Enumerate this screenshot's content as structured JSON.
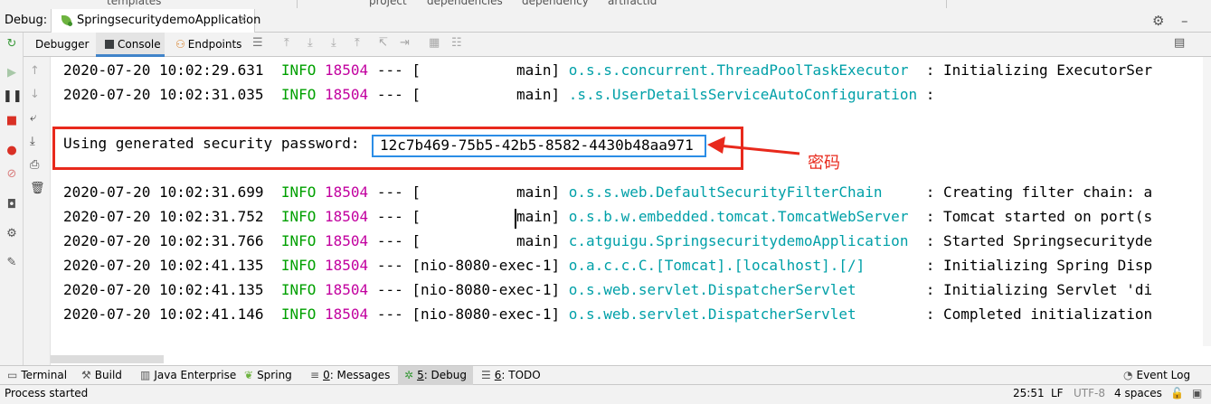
{
  "top_strip": {
    "fragments": [
      "templates",
      "project",
      "dependencies",
      "dependency",
      "artifactId"
    ]
  },
  "title_bar": {
    "label": "Debug:",
    "run_tab": "SpringsecuritydemoApplication",
    "close": "×",
    "settings_icon": "gear-icon",
    "minimize_icon": "minimize-icon"
  },
  "tabs": {
    "debugger": "Debugger",
    "console": "Console",
    "endpoints": "Endpoints",
    "active": "Console"
  },
  "console": {
    "lines_top": [
      {
        "date": "2020-07-20 10:02:29.631",
        "level": "INFO",
        "pid": "18504",
        "sep": "---",
        "thread": "[           main]",
        "logger": "o.s.s.concurrent.ThreadPoolTaskExecutor",
        "message": ": Initializing ExecutorSer"
      },
      {
        "date": "2020-07-20 10:02:31.035",
        "level": "INFO",
        "pid": "18504",
        "sep": "---",
        "thread": "[           main]",
        "logger": ".s.s.UserDetailsServiceAutoConfiguration",
        "message": ":"
      }
    ],
    "password_line": {
      "prefix": "Using generated security password:",
      "value": "12c7b469-75b5-42b5-8582-4430b48aa971"
    },
    "lines_bottom": [
      {
        "date": "2020-07-20 10:02:31.699",
        "level": "INFO",
        "pid": "18504",
        "sep": "---",
        "thread": "[           main]",
        "logger": "o.s.s.web.DefaultSecurityFilterChain",
        "message": ": Creating filter chain: a"
      },
      {
        "date": "2020-07-20 10:02:31.752",
        "level": "INFO",
        "pid": "18504",
        "sep": "---",
        "thread": "[           main]",
        "logger": "o.s.b.w.embedded.tomcat.TomcatWebServer",
        "message": ": Tomcat started on port(s"
      },
      {
        "date": "2020-07-20 10:02:31.766",
        "level": "INFO",
        "pid": "18504",
        "sep": "---",
        "thread": "[           main]",
        "logger": "c.atguigu.SpringsecuritydemoApplication",
        "message": ": Started Springsecurityde"
      },
      {
        "date": "2020-07-20 10:02:41.135",
        "level": "INFO",
        "pid": "18504",
        "sep": "---",
        "thread": "[nio-8080-exec-1]",
        "logger": "o.a.c.c.C.[Tomcat].[localhost].[/]",
        "message": ": Initializing Spring Disp"
      },
      {
        "date": "2020-07-20 10:02:41.135",
        "level": "INFO",
        "pid": "18504",
        "sep": "---",
        "thread": "[nio-8080-exec-1]",
        "logger": "o.s.web.servlet.DispatcherServlet",
        "message": ": Initializing Servlet 'di"
      },
      {
        "date": "2020-07-20 10:02:41.146",
        "level": "INFO",
        "pid": "18504",
        "sep": "---",
        "thread": "[nio-8080-exec-1]",
        "logger": "o.s.web.servlet.DispatcherServlet",
        "message": ": Completed initialization"
      }
    ],
    "annotation": "密码"
  },
  "bottom_tools": {
    "terminal": "Terminal",
    "build": "Build",
    "java_enterprise": "Java Enterprise",
    "spring": "Spring",
    "messages_num": "0",
    "messages": ": Messages",
    "debug_num": "5",
    "debug": ": Debug",
    "todo_num": "6",
    "todo": ": TODO",
    "event_log": "Event Log"
  },
  "status_bar": {
    "process": "Process started",
    "position": "25:51",
    "line_sep": "LF",
    "encoding": "UTF-8",
    "indent": "4 spaces"
  },
  "colors": {
    "info": "#00a000",
    "pid": "#c2009f",
    "logger": "#00a0a8",
    "annotation_red": "#e8291c",
    "highlight_blue": "#2b8de6"
  }
}
